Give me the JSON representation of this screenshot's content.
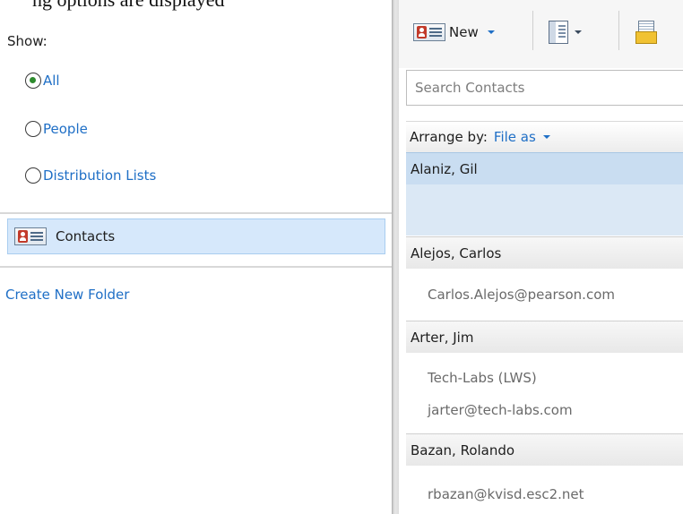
{
  "top_strip_text": "ng options are displayed",
  "sidebar": {
    "show_label": "Show:",
    "filters": [
      {
        "label": "All",
        "checked": true
      },
      {
        "label": "People",
        "checked": false
      },
      {
        "label": "Distribution Lists",
        "checked": false
      }
    ],
    "folder": {
      "label": "Contacts",
      "icon": "contact-card-icon"
    },
    "create_folder_label": "Create New Folder"
  },
  "toolbar": {
    "new_label": "New",
    "new_icon": "contact-card-icon",
    "view_icon": "reading-pane-icon",
    "mail_icon": "mail-merge-icon"
  },
  "search": {
    "placeholder": "Search Contacts"
  },
  "arrange": {
    "label": "Arrange by:",
    "value": "File as"
  },
  "contacts": [
    {
      "name": "Alaniz, Gil",
      "details": [],
      "selected": true
    },
    {
      "name": "Alejos, Carlos",
      "details": [
        "Carlos.Alejos@pearson.com"
      ],
      "selected": false
    },
    {
      "name": "Arter, Jim",
      "details": [
        "Tech-Labs (LWS)",
        "jarter@tech-labs.com"
      ],
      "selected": false
    },
    {
      "name": "Bazan, Rolando",
      "details": [
        "rbazan@kvisd.esc2.net"
      ],
      "selected": false
    }
  ],
  "colors": {
    "accent": "#1f6fc6",
    "selection": "#d6e8fb",
    "radio_checked": "#2e8b2e"
  }
}
